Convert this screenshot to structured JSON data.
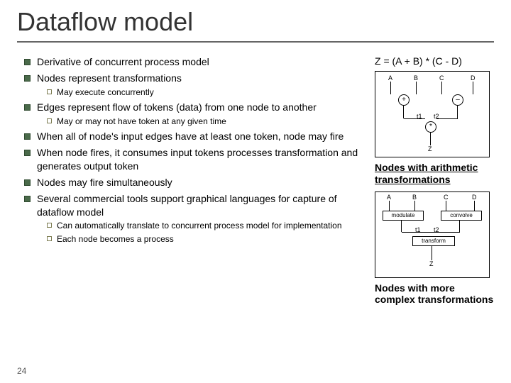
{
  "title": "Dataflow model",
  "page_number": "24",
  "equation": "Z = (A + B) * (C - D)",
  "bullets": {
    "b0": "Derivative of concurrent process model",
    "b1": "Nodes represent transformations",
    "b1s0": "May execute concurrently",
    "b2": "Edges represent flow of tokens (data) from one node to another",
    "b2s0": "May or may not have token at any given time",
    "b3": "When all of node's input edges have at least one token, node may fire",
    "b4": "When node fires, it consumes input tokens processes transformation and generates output token",
    "b5": "Nodes may fire simultaneously",
    "b6": "Several commercial tools support graphical languages for capture of dataflow model",
    "b6s0": "Can automatically translate to concurrent process model for implementation",
    "b6s1": "Each node becomes a process"
  },
  "captions": {
    "c1": "Nodes with arithmetic transformations",
    "c2": "Nodes with more complex transformations"
  },
  "diagram1": {
    "A": "A",
    "B": "B",
    "C": "C",
    "D": "D",
    "plus": "+",
    "minus": "–",
    "mul": "*",
    "t1": "t1",
    "t2": "t2",
    "Z": "Z"
  },
  "diagram2": {
    "A": "A",
    "B": "B",
    "C": "C",
    "D": "D",
    "mod": "modulate",
    "conv": "convolve",
    "trans": "transform",
    "t1": "t1",
    "t2": "t2",
    "Z": "Z"
  }
}
